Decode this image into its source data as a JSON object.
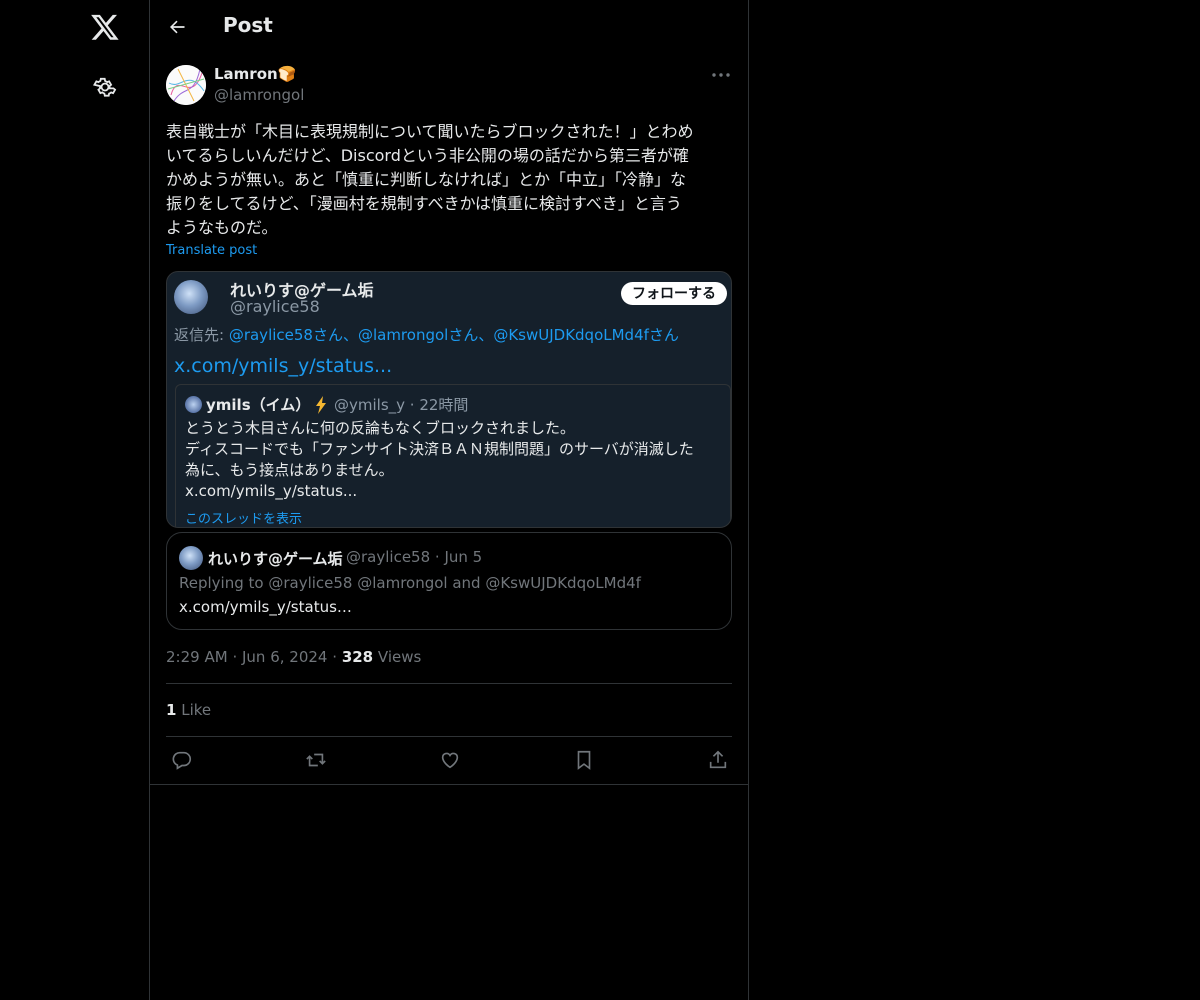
{
  "nav": {
    "logo_icon": "x-logo-icon",
    "settings_icon": "gear-icon"
  },
  "header": {
    "title": "Post"
  },
  "author": {
    "name": "Lamron🍞",
    "handle": "@lamrongol"
  },
  "post": {
    "text": "表自戦士が「木目に表現規制について聞いたらブロックされた！」とわめ\nいてるらしいんだけど、Discordという非公開の場の話だから第三者が確\nかめようが無い。あと「慎重に判断しなければ」とか「中立」「冷静」な\n振りをしてるけど、「漫画村を規制すべきかは慎重に検討すべき」と言う\nようなものだ。",
    "translate_label": "Translate post"
  },
  "embedded_screenshot": {
    "name": "れいりす@ゲーム垢",
    "handle": "@raylice58",
    "follow_label": "フォローする",
    "reply_prefix": "返信先: ",
    "reply_mentions": "@raylice58さん、@lamrongolさん、@KswUJDKdqoLMd4fさん",
    "link": "x.com/ymils_y/status...",
    "inner": {
      "name": "ymils（イム）",
      "meta": "@ymils_y · 22時間",
      "text": "とうとう木目さんに何の反論もなくブロックされました。\nディスコードでも「ファンサイト決済ＢＡＮ規制問題」のサーバが消滅した\n為に、もう接点はありません。\nx.com/ymils_y/status...",
      "show_thread": "このスレッドを表示"
    }
  },
  "quote": {
    "name": "れいりす@ゲーム垢",
    "meta": "@raylice58 · Jun 5",
    "reply": "Replying to @raylice58 @lamrongol and @KswUJDKdqoLMd4f",
    "link": "x.com/ymils_y/status…"
  },
  "meta": {
    "time": "2:29 AM",
    "date": "Jun 6, 2024",
    "views_count": "328",
    "views_label": "Views",
    "dot": "·"
  },
  "stats": {
    "likes_count": "1",
    "likes_label": "Like"
  },
  "actions": [
    {
      "icon": "reply-icon"
    },
    {
      "icon": "repost-icon"
    },
    {
      "icon": "like-icon"
    },
    {
      "icon": "bookmark-icon"
    },
    {
      "icon": "share-icon"
    }
  ]
}
